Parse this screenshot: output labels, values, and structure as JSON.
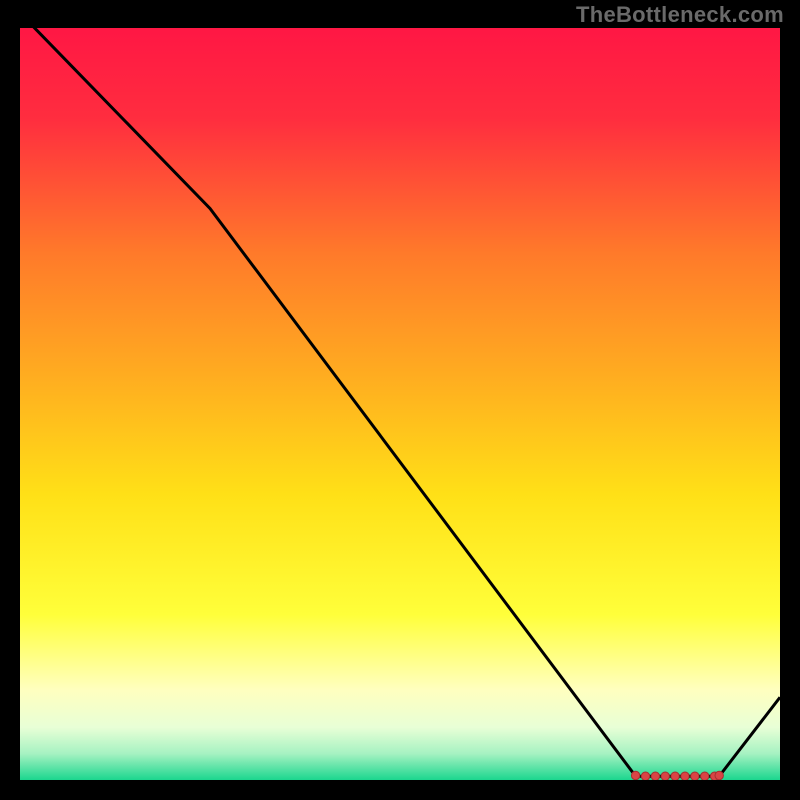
{
  "watermark": "TheBottleneck.com",
  "colors": {
    "black": "#000000",
    "line": "#000000",
    "marker_fill": "#d94545",
    "marker_stroke": "#a63030"
  },
  "chart_data": {
    "type": "line",
    "title": "",
    "xlabel": "",
    "ylabel": "",
    "xlim": [
      0,
      100
    ],
    "ylim": [
      0,
      100
    ],
    "grid": false,
    "legend": false,
    "gradient_stops": [
      {
        "offset": 0.0,
        "color": "#ff1744"
      },
      {
        "offset": 0.12,
        "color": "#ff2d3f"
      },
      {
        "offset": 0.3,
        "color": "#ff7a2a"
      },
      {
        "offset": 0.48,
        "color": "#ffb21f"
      },
      {
        "offset": 0.62,
        "color": "#ffe017"
      },
      {
        "offset": 0.78,
        "color": "#ffff3a"
      },
      {
        "offset": 0.88,
        "color": "#ffffbf"
      },
      {
        "offset": 0.93,
        "color": "#e8ffd6"
      },
      {
        "offset": 0.965,
        "color": "#a6f2c2"
      },
      {
        "offset": 1.0,
        "color": "#1bd68e"
      }
    ],
    "series": [
      {
        "name": "bottleneck-curve",
        "x": [
          0,
          25,
          81,
          92,
          100
        ],
        "y": [
          102,
          76,
          0.5,
          0.5,
          11
        ]
      }
    ],
    "markers": {
      "name": "optimal-range",
      "x": [
        81,
        82.3,
        83.6,
        84.9,
        86.2,
        87.5,
        88.8,
        90.1,
        91.4,
        92
      ],
      "y": [
        0.6,
        0.5,
        0.5,
        0.5,
        0.5,
        0.5,
        0.5,
        0.5,
        0.5,
        0.6
      ]
    }
  }
}
